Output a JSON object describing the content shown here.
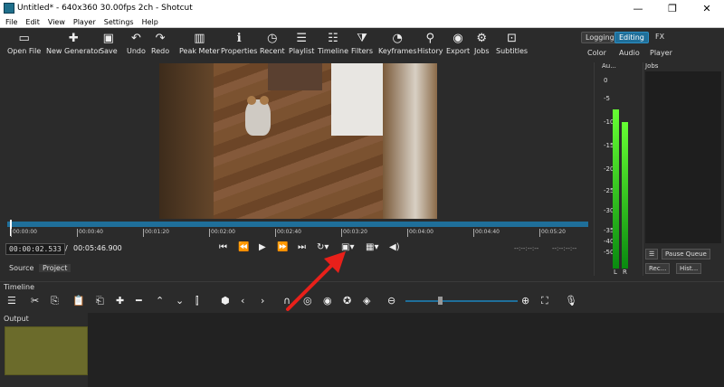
{
  "window": {
    "title": "Untitled* - 640x360 30.00fps 2ch - Shotcut",
    "minimize": "—",
    "maximize": "❐",
    "close": "✕"
  },
  "menu": [
    "File",
    "Edit",
    "View",
    "Player",
    "Settings",
    "Help"
  ],
  "toolbar": [
    {
      "label": "Open File",
      "icon": "folder-icon"
    },
    {
      "label": "New Generator",
      "icon": "generator-icon"
    },
    {
      "label": "Save",
      "icon": "save-icon"
    },
    {
      "label": "Undo",
      "icon": "undo-icon"
    },
    {
      "label": "Redo",
      "icon": "redo-icon"
    },
    {
      "label": "Peak Meter",
      "icon": "meter-icon"
    },
    {
      "label": "Properties",
      "icon": "info-icon"
    },
    {
      "label": "Recent",
      "icon": "clock-icon"
    },
    {
      "label": "Playlist",
      "icon": "playlist-icon"
    },
    {
      "label": "Timeline",
      "icon": "timeline-icon"
    },
    {
      "label": "Filters",
      "icon": "filter-icon"
    },
    {
      "label": "Keyframes",
      "icon": "stopwatch-icon"
    },
    {
      "label": "History",
      "icon": "history-icon"
    },
    {
      "label": "Export",
      "icon": "export-icon"
    },
    {
      "label": "Jobs",
      "icon": "gear-icon"
    },
    {
      "label": "Subtitles",
      "icon": "subtitles-icon"
    }
  ],
  "layouts": {
    "logging": "Logging",
    "editing": "Editing",
    "fx": "FX",
    "color": "Color",
    "audio": "Audio",
    "player": "Player"
  },
  "accent": "#1f6f9a",
  "scrubber": {
    "ticks": [
      "00:00:00",
      "00:00:40",
      "00:01:20",
      "00:02:00",
      "00:02:40",
      "00:03:20",
      "00:04:00",
      "00:04:40",
      "00:05:20"
    ]
  },
  "transport": {
    "position": "00:00:02.533",
    "separator": "/",
    "duration": "00:05:46.900",
    "in_point": "--:--:--:--",
    "out_point": "--:--:--:--"
  },
  "tabs": {
    "source": "Source",
    "project": "Project"
  },
  "audio_meter": {
    "title": "Au...",
    "scale": [
      "0",
      "-5",
      "-10",
      "-15",
      "-20",
      "-25",
      "-30",
      "-35",
      "-40",
      "-50"
    ],
    "left": "L",
    "right": "R"
  },
  "jobs": {
    "title": "Jobs",
    "pause_queue": "Pause Queue",
    "recent": "Rec...",
    "history": "Hist..."
  },
  "timeline": {
    "title": "Timeline",
    "track": "Output"
  }
}
